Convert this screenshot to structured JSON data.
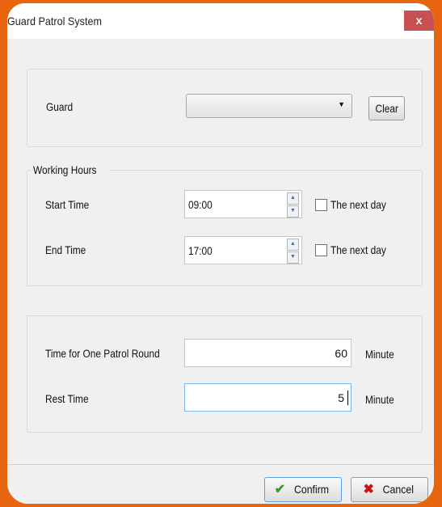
{
  "window": {
    "title": "Guard Patrol System",
    "close_label": "x"
  },
  "guard": {
    "label": "Guard",
    "selected": "",
    "clear_label": "Clear"
  },
  "working_hours": {
    "legend": "Working Hours",
    "start_label": "Start Time",
    "start_value": "09:00",
    "start_next_day_label": "The next day",
    "start_next_day_checked": false,
    "end_label": "End Time",
    "end_value": "17:00",
    "end_next_day_label": "The next day",
    "end_next_day_checked": false
  },
  "patrol": {
    "round_label": "Time for One Patrol Round",
    "round_value": "60",
    "round_unit": "Minute",
    "rest_label": "Rest Time",
    "rest_value": "5",
    "rest_unit": "Minute"
  },
  "footer": {
    "confirm_label": "Confirm",
    "cancel_label": "Cancel"
  },
  "colors": {
    "frame": "#e8650f",
    "close": "#c75050",
    "confirm_icon": "#3a9a2a",
    "cancel_icon": "#cc1111"
  }
}
